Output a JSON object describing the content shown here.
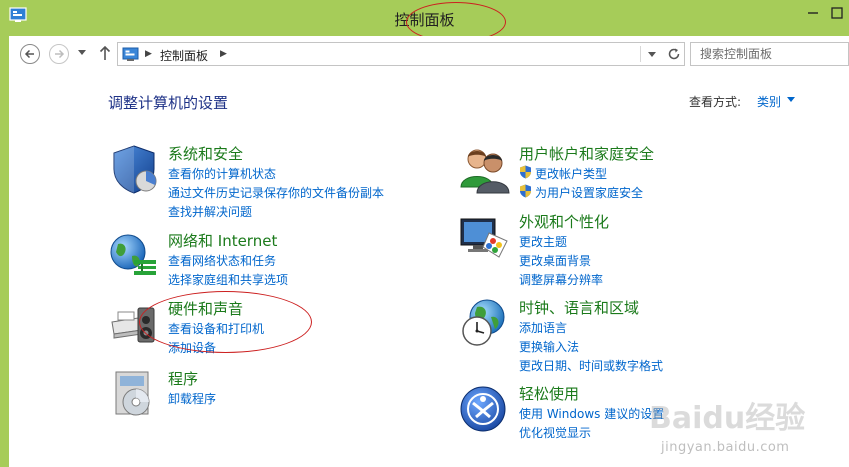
{
  "window": {
    "title": "控制面板"
  },
  "navigation": {
    "breadcrumb": "控制面板",
    "search_placeholder": "搜索控制面板"
  },
  "content": {
    "heading": "调整计算机的设置",
    "view_by_label": "查看方式:",
    "view_by_value": "类别"
  },
  "categories": [
    {
      "title": "系统和安全",
      "icon": "shield-icon",
      "links": [
        "查看你的计算机状态",
        "通过文件历史记录保存你的文件备份副本",
        "查找并解决问题"
      ]
    },
    {
      "title": "网络和 Internet",
      "icon": "network-globe-icon",
      "links": [
        "查看网络状态和任务",
        "选择家庭组和共享选项"
      ]
    },
    {
      "title": "硬件和声音",
      "icon": "printer-speaker-icon",
      "links": [
        "查看设备和打印机",
        "添加设备"
      ]
    },
    {
      "title": "程序",
      "icon": "programs-disc-icon",
      "links": [
        "卸载程序"
      ]
    },
    {
      "title": "用户帐户和家庭安全",
      "icon": "users-icon",
      "links": [
        "更改帐户类型",
        "为用户设置家庭安全"
      ]
    },
    {
      "title": "外观和个性化",
      "icon": "monitor-palette-icon",
      "links": [
        "更改主题",
        "更改桌面背景",
        "调整屏幕分辨率"
      ]
    },
    {
      "title": "时钟、语言和区域",
      "icon": "clock-globe-icon",
      "links": [
        "添加语言",
        "更换输入法",
        "更改日期、时间或数字格式"
      ]
    },
    {
      "title": "轻松使用",
      "icon": "ease-of-access-icon",
      "links": [
        "使用 Windows 建议的设置",
        "优化视觉显示"
      ]
    }
  ],
  "watermark": {
    "brand": "Baidu经验",
    "url": "jingyan.baidu.com"
  },
  "colors": {
    "titlebar": "#a6cc59",
    "heading": "#1e3287",
    "category_title": "#1b7a1b",
    "link": "#0066cc",
    "annotation": "#cc2020"
  }
}
